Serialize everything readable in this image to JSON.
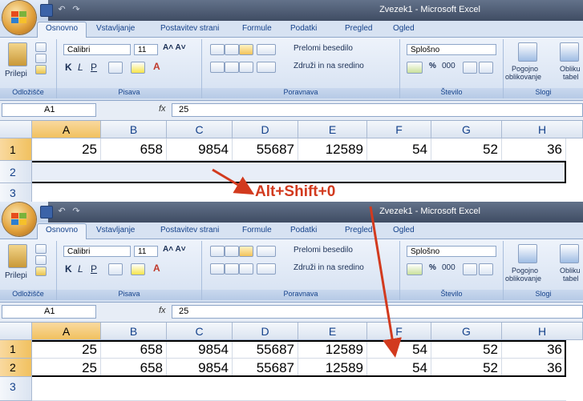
{
  "app": {
    "window_title": "Zvezek1 - Microsoft Excel",
    "tabs": [
      "Osnovno",
      "Vstavljanje",
      "Postavitev strani",
      "Formule",
      "Podatki",
      "Pregled",
      "Ogled"
    ],
    "active_tab": "Osnovno"
  },
  "ribbon": {
    "clipboard": {
      "paste_label": "Prilepi",
      "group_label": "Odložišče"
    },
    "font": {
      "font_name": "Calibri",
      "font_size": "11",
      "bold": "K",
      "italic": "L",
      "underline": "P",
      "group_label": "Pisava"
    },
    "alignment": {
      "wrap_text": "Prelomi besedilo",
      "merge_center": "Združi in na sredino",
      "group_label": "Poravnava"
    },
    "number": {
      "format": "Splošno",
      "percent": "%",
      "thousands": "000",
      "group_label": "Število"
    },
    "styles": {
      "conditional_formatting": "Pogojno",
      "conditional_formatting_2": "oblikovanje",
      "format_table": "Obliku",
      "format_table_2": "tabel",
      "group_label": "Slogi"
    }
  },
  "formula_bar": {
    "name_box": "A1",
    "fx_label": "fx",
    "value": "25"
  },
  "sheet": {
    "columns": [
      "A",
      "B",
      "C",
      "D",
      "E",
      "F",
      "G",
      "H"
    ],
    "row_headers": [
      "1",
      "2",
      "3"
    ],
    "row1": [
      "25",
      "658",
      "9854",
      "55687",
      "12589",
      "54",
      "52",
      "36"
    ],
    "row2_after": [
      "25",
      "658",
      "9854",
      "55687",
      "12589",
      "54",
      "52",
      "36"
    ]
  },
  "annotation": {
    "shortcut": "Alt+Shift+0"
  },
  "colors": {
    "accent_red": "#d23a1e",
    "ribbon_blue": "#15428b",
    "selection_orange": "#f1c15f"
  }
}
